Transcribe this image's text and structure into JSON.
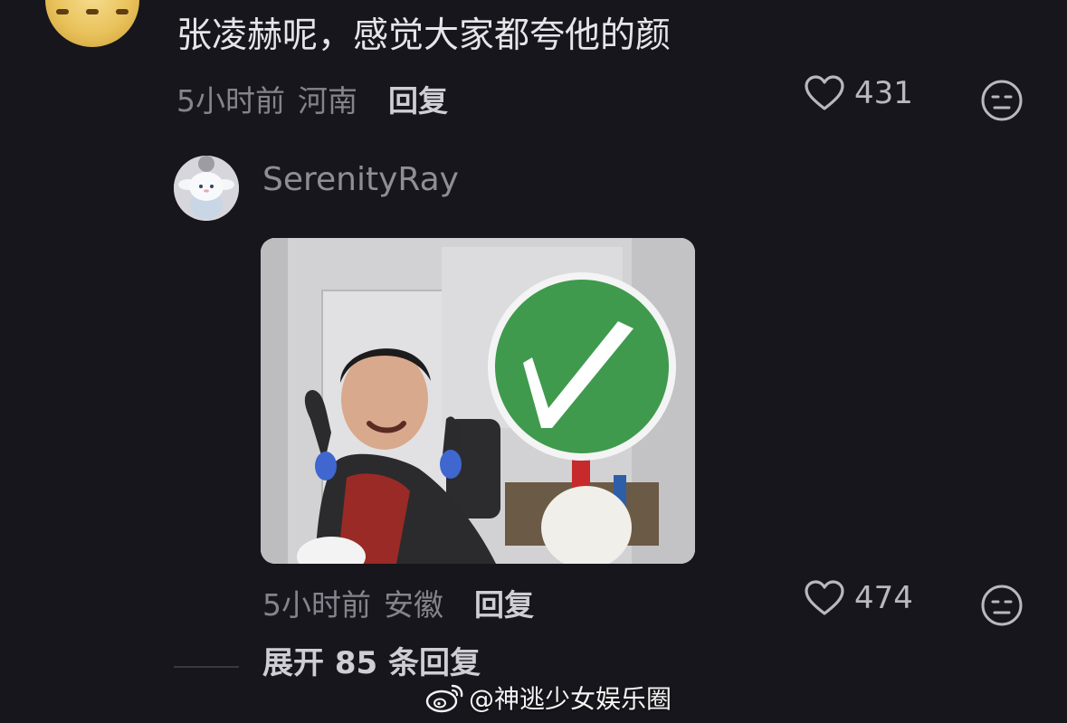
{
  "top_comment": {
    "text": "张凌赫呢，感觉大家都夸他的颜",
    "time": "5小时前",
    "region": "河南",
    "reply_label": "回复",
    "likes": "431"
  },
  "reply_comment": {
    "username": "SerenityRay",
    "time": "5小时前",
    "region": "安徽",
    "reply_label": "回复",
    "likes": "474"
  },
  "expand": {
    "label": "展开 85 条回复"
  },
  "watermark": {
    "text": "@神逃少女娱乐圈"
  },
  "icons": {
    "like": "heart-outline-icon",
    "reaction": "neutral-face-icon",
    "watermark": "weibo-logo-icon"
  },
  "colors": {
    "background": "#17161c",
    "primary_text": "#e6e5ea",
    "secondary_text": "#85848c",
    "sign_green": "#3f9a4d"
  }
}
